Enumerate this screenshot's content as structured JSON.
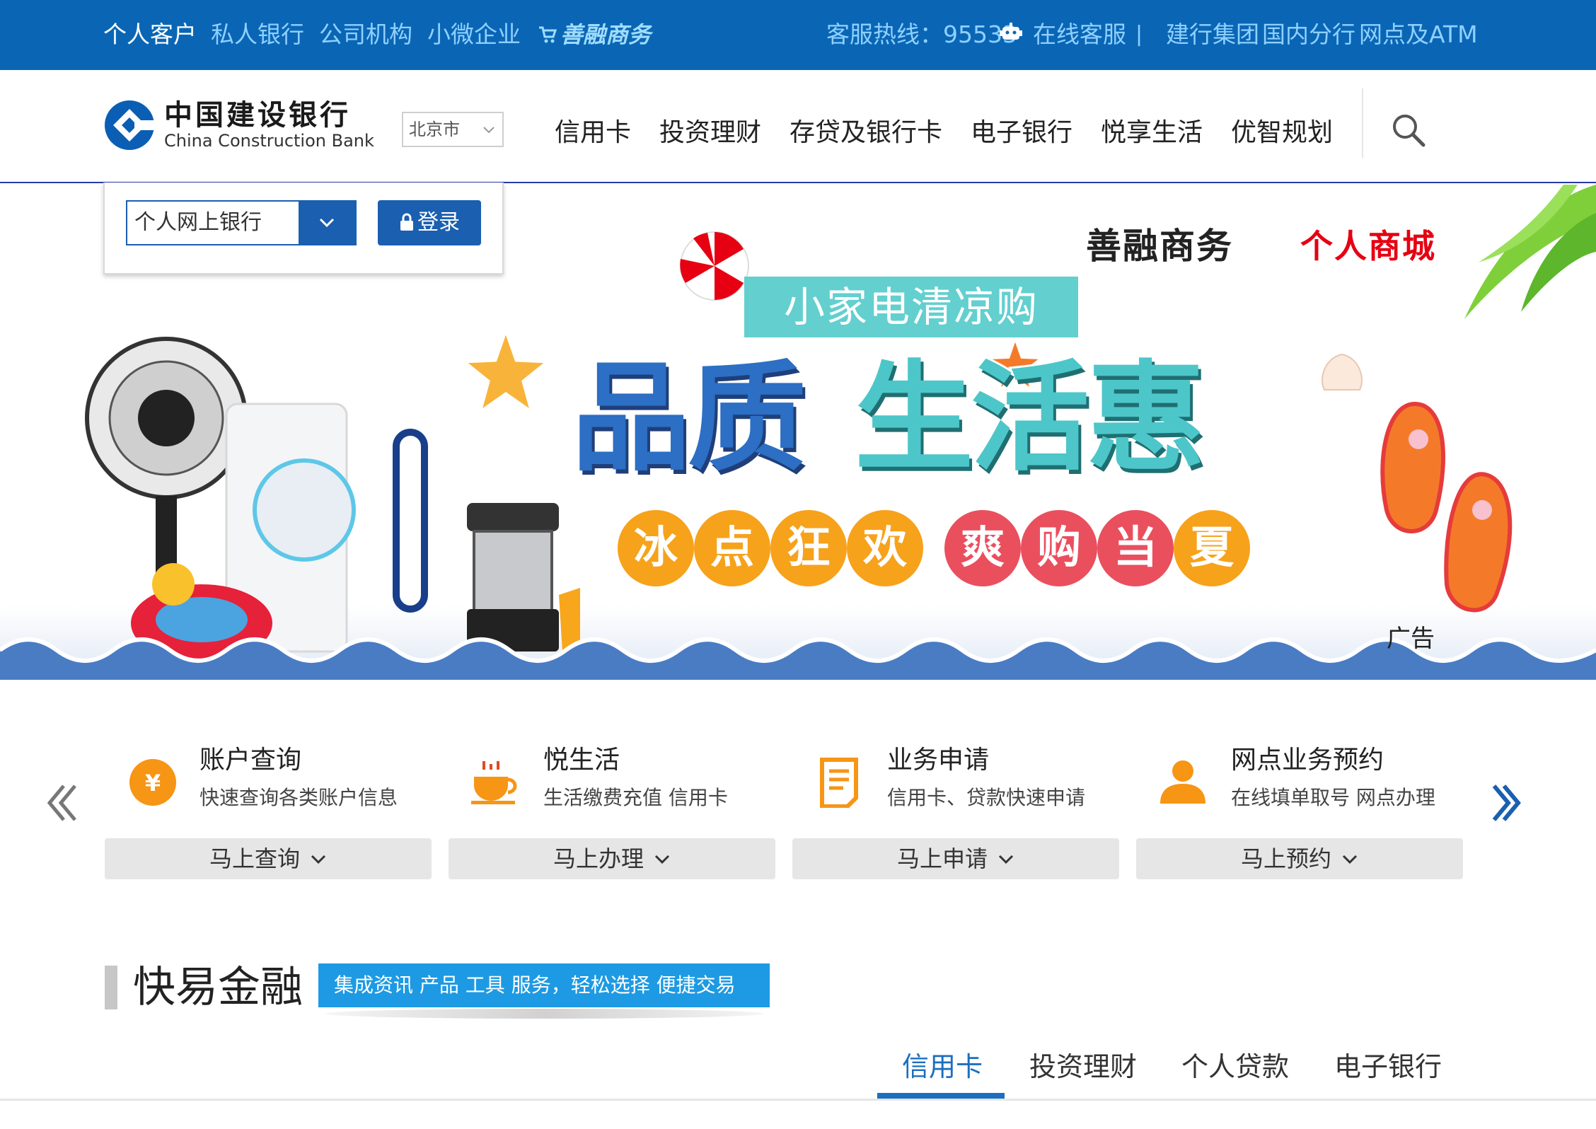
{
  "topbar": {
    "left_links": [
      "个人客户",
      "私人银行",
      "公司机构",
      "小微企业"
    ],
    "shanrong": "善融商务",
    "hotline": "客服热线：95533",
    "online_service": "在线客服",
    "separator": "|",
    "right_links": [
      "建行集团",
      "国内分行",
      "网点及ATM"
    ],
    "colors": {
      "background": "#0a66b5",
      "active_link": "#ffffff",
      "link": "#8fd0ff"
    }
  },
  "header": {
    "logo_cn": "中国建设银行",
    "logo_en": "China Construction Bank",
    "city_select": "北京市",
    "nav": [
      "信用卡",
      "投资理财",
      "存贷及银行卡",
      "电子银行",
      "悦享生活",
      "优智规划"
    ],
    "search_icon": "search-icon"
  },
  "login": {
    "select_value": "个人网上银行",
    "button": "登录"
  },
  "banner": {
    "mall_left": "善融商务",
    "mall_right": "个人商城",
    "subtitle": "小家电清凉购",
    "headline_part1": "品质",
    "headline_part2": "生活惠",
    "circles": [
      "冰",
      "点",
      "狂",
      "欢",
      "爽",
      "购",
      "当",
      "夏"
    ],
    "ad_label": "广告"
  },
  "services": [
    {
      "icon": "yen-coin-icon",
      "title": "账户查询",
      "desc": "快速查询各类账户信息",
      "button": "马上查询"
    },
    {
      "icon": "coffee-cup-icon",
      "title": "悦生活",
      "desc": "生活缴费充值 信用卡",
      "button": "马上办理"
    },
    {
      "icon": "document-icon",
      "title": "业务申请",
      "desc": "信用卡、贷款快速申请",
      "button": "马上申请"
    },
    {
      "icon": "person-icon",
      "title": "网点业务预约",
      "desc": "在线填单取号 网点办理",
      "button": "马上预约"
    }
  ],
  "quick_finance": {
    "title": "快易金融",
    "tagline": "集成资讯 产品 工具 服务，轻松选择 便捷交易",
    "tabs": [
      "信用卡",
      "投资理财",
      "个人贷款",
      "电子银行"
    ],
    "active_tab": "信用卡"
  }
}
